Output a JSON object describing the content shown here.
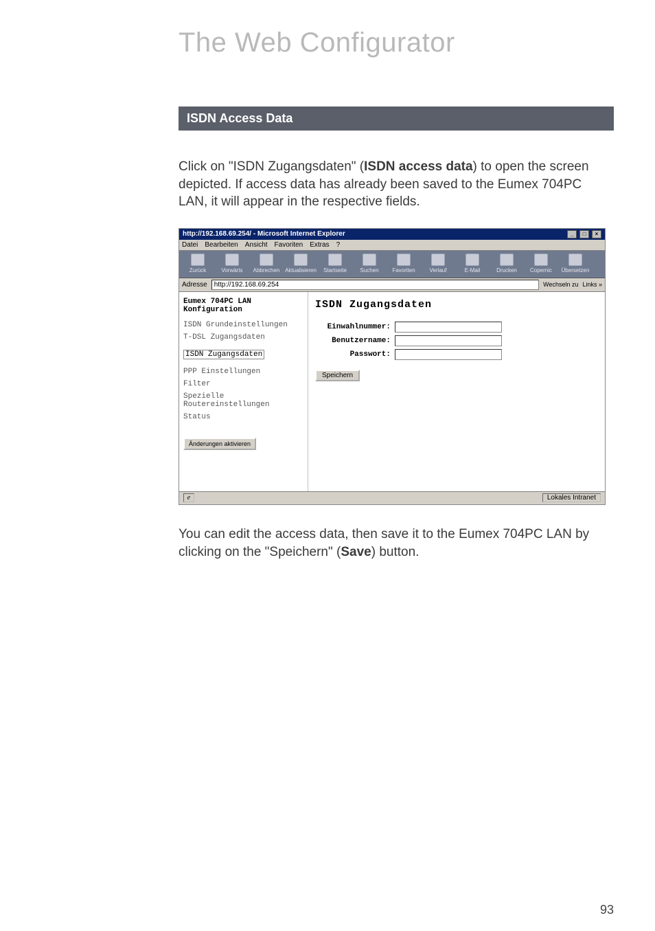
{
  "page": {
    "big_title": "The Web Configurator",
    "section_bar": "ISDN Access Data",
    "para1_pre": "Click on \"ISDN Zugangsdaten\" (",
    "para1_em": "ISDN access data",
    "para1_post": ") to open the screen depicted. If access data has already been saved to the Eumex 704PC LAN, it will appear in the respective fields.",
    "para2_pre": "You can edit the access data, then save it to the Eumex 704PC LAN by clicking on the \"Speichern\" (",
    "para2_em": "Save",
    "para2_post": ") button.",
    "page_number": "93"
  },
  "shot": {
    "window_title": "http://192.168.69.254/ - Microsoft Internet Explorer",
    "winbtns": {
      "min": "_",
      "max": "□",
      "close": "×"
    },
    "menus": {
      "datei": "Datei",
      "bearbeiten": "Bearbeiten",
      "ansicht": "Ansicht",
      "favoriten": "Favoriten",
      "extras": "Extras",
      "hilfe": "?"
    },
    "toolbar": {
      "zurueck": "Zurück",
      "vorwaerts": "Vorwärts",
      "abbrechen": "Abbrechen",
      "aktualisieren": "Aktualisieren",
      "startseite": "Startseite",
      "suchen": "Suchen",
      "favoriten": "Favoriten",
      "verlauf": "Verlauf",
      "email": "E-Mail",
      "drucken": "Drucken",
      "copernic": "Copernic",
      "uebersetzen": "Übersetzen"
    },
    "addr": {
      "label": "Adresse",
      "url": "http://192.168.69.254",
      "wechseln": "Wechseln zu",
      "links": "Links »"
    },
    "sidebar": {
      "heading": "Eumex 704PC LAN Konfiguration",
      "items": {
        "isdn": "ISDN Grundeinstellungen",
        "tdsl": "T-DSL Zugangsdaten",
        "isdn_z": "ISDN Zugangsdaten",
        "ppp": "PPP Einstellungen",
        "filter": "Filter",
        "router": "Spezielle Routereinstellungen",
        "status": "Status"
      },
      "activate_btn": "Änderungen aktivieren"
    },
    "content": {
      "heading": "ISDN Zugangsdaten",
      "labels": {
        "einwahl": "Einwahlnummer:",
        "benutzer": "Benutzername:",
        "passwort": "Passwort:"
      },
      "values": {
        "einwahl": "",
        "benutzer": "",
        "passwort": ""
      },
      "save_btn": "Speichern"
    },
    "status": {
      "left_e": "e",
      "zone": "Lokales Intranet"
    }
  }
}
